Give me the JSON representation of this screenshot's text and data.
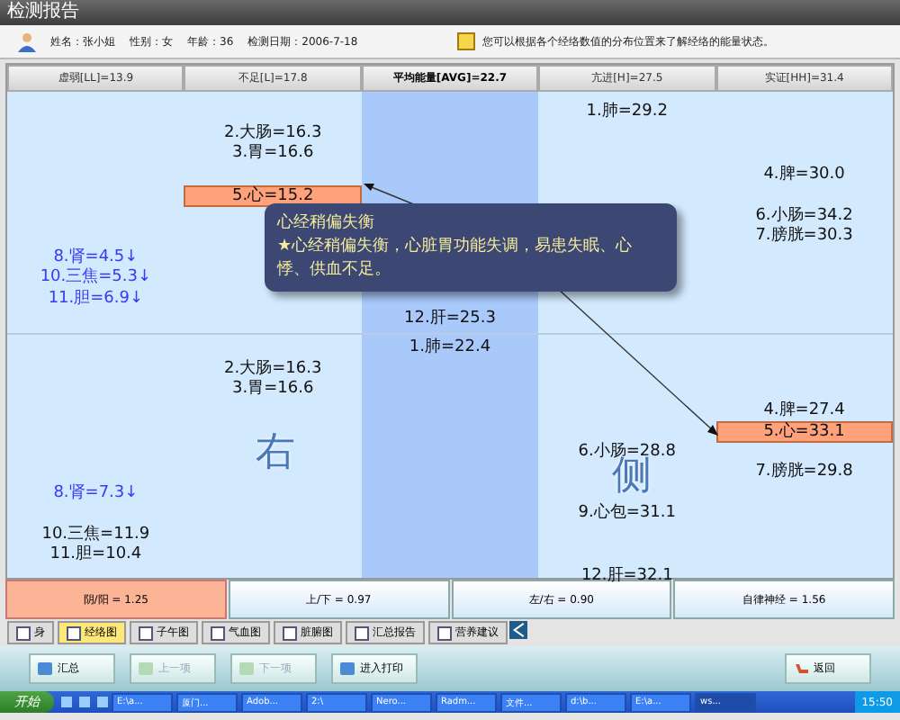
{
  "window": {
    "title": "检测报告"
  },
  "info": {
    "fields": [
      "姓名：张小姐",
      "性别：女",
      "年龄：36",
      "检测日期：2006-7-18"
    ],
    "note": "您可以根据各个经络数值的分布位置来了解经络的能量状态。"
  },
  "levels": [
    {
      "label": "虚弱[LL]=13.9",
      "selected": false
    },
    {
      "label": "不足[L]=17.8",
      "selected": false
    },
    {
      "label": "平均能量[AVG]=22.7",
      "selected": true
    },
    {
      "label": "亢进[H]=27.5",
      "selected": false
    },
    {
      "label": "实证[HH]=31.4",
      "selected": false
    }
  ],
  "halves": [
    {
      "entries": [
        {
          "label": "1.肺=29.2",
          "kind": "h",
          "selected": false,
          "deficient": false
        },
        {
          "label": "2.大肠=16.3",
          "kind": "l",
          "selected": false,
          "deficient": false
        },
        {
          "label": "3.胃=16.6",
          "kind": "l",
          "selected": false,
          "deficient": false
        },
        {
          "label": "4.脾=30.0",
          "kind": "hh",
          "selected": false,
          "deficient": false
        },
        {
          "label": "5.心=15.2",
          "kind": "l",
          "selected": true,
          "deficient": false
        },
        {
          "label": "6.小肠=34.2",
          "kind": "hh",
          "selected": false,
          "deficient": false
        },
        {
          "label": "7.膀胱=30.3",
          "kind": "hh",
          "selected": false,
          "deficient": false
        },
        {
          "label": "8.肾=4.5↓",
          "kind": "ll",
          "selected": false,
          "deficient": true
        },
        {
          "label": "10.三焦=5.3↓",
          "kind": "ll",
          "selected": false,
          "deficient": true
        },
        {
          "label": "11.胆=6.9↓",
          "kind": "ll",
          "selected": false,
          "deficient": true
        },
        {
          "label": "12.肝=25.3",
          "kind": "avg",
          "selected": false,
          "deficient": false
        }
      ]
    },
    {
      "side": "右",
      "side_2": "侧",
      "entries": [
        {
          "label": "1.肺=22.4",
          "kind": "avg",
          "selected": false,
          "deficient": false
        },
        {
          "label": "2.大肠=16.3",
          "kind": "l",
          "selected": false,
          "deficient": false
        },
        {
          "label": "3.胃=16.6",
          "kind": "l",
          "selected": false,
          "deficient": false
        },
        {
          "label": "4.脾=27.4",
          "kind": "hh",
          "selected": false,
          "deficient": false
        },
        {
          "label": "5.心=33.1",
          "kind": "hh",
          "selected": true,
          "deficient": false
        },
        {
          "label": "6.小肠=28.8",
          "kind": "h",
          "selected": false,
          "deficient": false
        },
        {
          "label": "7.膀胱=29.8",
          "kind": "hh",
          "selected": false,
          "deficient": false
        },
        {
          "label": "8.肾=7.3↓",
          "kind": "ll",
          "selected": false,
          "deficient": true
        },
        {
          "label": "9.心包=31.1",
          "kind": "h",
          "selected": false,
          "deficient": false
        },
        {
          "label": "10.三焦=11.9",
          "kind": "ll",
          "selected": false,
          "deficient": false
        },
        {
          "label": "11.胆=10.4",
          "kind": "ll",
          "selected": false,
          "deficient": false
        },
        {
          "label": "12.肝=32.1",
          "kind": "h",
          "selected": false,
          "deficient": false
        }
      ]
    }
  ],
  "tooltip": {
    "title": "心经稍偏失衡",
    "text": "★心经稍偏失衡，心脏胃功能失调，易患失眠、心悸、供血不足。"
  },
  "ratios": [
    {
      "label": "阴/阳 = 1.25",
      "selected": true
    },
    {
      "label": "上/下 = 0.97",
      "selected": false
    },
    {
      "label": "左/右 = 0.90",
      "selected": false
    },
    {
      "label": "自律神经 = 1.56",
      "selected": false
    }
  ],
  "tabs": [
    {
      "label": "身",
      "selected": false
    },
    {
      "label": "经络图",
      "selected": true
    },
    {
      "label": "子午图",
      "selected": false
    },
    {
      "label": "气血图",
      "selected": false
    },
    {
      "label": "脏腑图",
      "selected": false
    },
    {
      "label": "汇总报告",
      "selected": false
    },
    {
      "label": "营养建议",
      "selected": false
    }
  ],
  "buttons": [
    {
      "label": "汇总",
      "disabled": false
    },
    {
      "label": "上一项",
      "disabled": true
    },
    {
      "label": "下一项",
      "disabled": true
    },
    {
      "label": "进入打印",
      "disabled": false
    }
  ],
  "back_button": {
    "label": "返回"
  },
  "taskbar": {
    "start": "开始",
    "tasks": [
      {
        "label": "E:\\a...",
        "selected": false
      },
      {
        "label": "厦门...",
        "selected": false
      },
      {
        "label": "Adob...",
        "selected": false
      },
      {
        "label": "2:\\",
        "selected": false
      },
      {
        "label": "Nero...",
        "selected": false
      },
      {
        "label": "Radm...",
        "selected": false
      },
      {
        "label": "文件...",
        "selected": false
      },
      {
        "label": "d:\\b...",
        "selected": false
      },
      {
        "label": "E:\\a...",
        "selected": false
      },
      {
        "label": "ws...",
        "selected": true
      }
    ],
    "clock": "15:50"
  }
}
